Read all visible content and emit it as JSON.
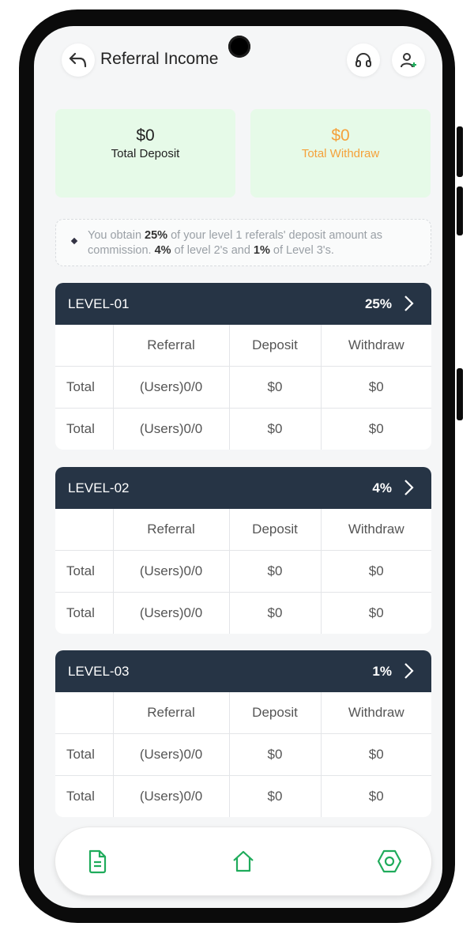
{
  "header": {
    "back_icon": "back-arrow-icon",
    "title": "Referral Income",
    "support_icon": "headphones-icon",
    "add_user_icon": "add-user-icon"
  },
  "stats": {
    "deposit": {
      "amount": "$0",
      "label": "Total Deposit",
      "color": "#222222"
    },
    "withdraw": {
      "amount": "$0",
      "label": "Total Withdraw",
      "color": "#f5a13a"
    }
  },
  "notice": {
    "t1": "You obtain ",
    "b1": "25%",
    "t2": " of your level 1 referals' deposit amount as commission. ",
    "b2": "4%",
    "t3": " of level 2's and ",
    "b3": "1%",
    "t4": " of Level 3's."
  },
  "levels": [
    {
      "name": "LEVEL-01",
      "percent": "25%",
      "columns": [
        "",
        "Referral",
        "Deposit",
        "Withdraw"
      ],
      "rows": [
        [
          "Total",
          "(Users)0/0",
          "$0",
          "$0"
        ],
        [
          "Total",
          "(Users)0/0",
          "$0",
          "$0"
        ]
      ]
    },
    {
      "name": "LEVEL-02",
      "percent": "4%",
      "columns": [
        "",
        "Referral",
        "Deposit",
        "Withdraw"
      ],
      "rows": [
        [
          "Total",
          "(Users)0/0",
          "$0",
          "$0"
        ],
        [
          "Total",
          "(Users)0/0",
          "$0",
          "$0"
        ]
      ]
    },
    {
      "name": "LEVEL-03",
      "percent": "1%",
      "columns": [
        "",
        "Referral",
        "Deposit",
        "Withdraw"
      ],
      "rows": [
        [
          "Total",
          "(Users)0/0",
          "$0",
          "$0"
        ],
        [
          "Total",
          "(Users)0/0",
          "$0",
          "$0"
        ]
      ]
    }
  ],
  "bottom_nav": {
    "items": [
      "document-icon",
      "home-icon",
      "settings-hexagon-icon"
    ],
    "accent": "#1fab5b"
  },
  "colors": {
    "level_header": "#263445",
    "stat_bg": "#e6fae8"
  }
}
